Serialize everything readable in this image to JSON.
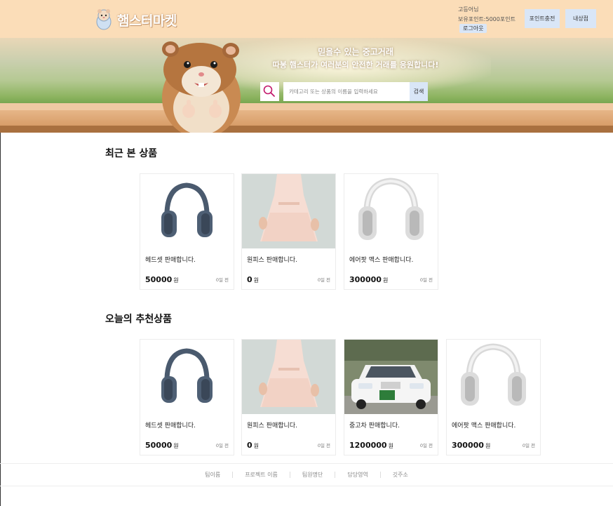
{
  "header": {
    "logo_text": "햄스터마켓",
    "user_name": "고등어님",
    "user_points": "보유포인트:5000포인트",
    "logout_label": "로그아웃",
    "charge_label": "포인트충전",
    "mystore_label": "내상점"
  },
  "banner": {
    "line1": "믿을수 있는 중고거래",
    "line2": "따봉 햄스터가 여러분의 안전한 거래를 응원합니다!",
    "search_placeholder": "카테고리 또는 상품의 이름을 입력하세요",
    "search_button": "검색"
  },
  "recent": {
    "title": "최근 본 상품",
    "items": [
      {
        "title": "헤드셋 판매합니다.",
        "price": "50000",
        "unit": "원",
        "time": "0일 전",
        "image": "headphones-blue"
      },
      {
        "title": "원피스 판매합니다.",
        "price": "0",
        "unit": "원",
        "time": "0일 전",
        "image": "dress-pink"
      },
      {
        "title": "에어팟 맥스 판매합니다.",
        "price": "300000",
        "unit": "원",
        "time": "0일 전",
        "image": "headphones-silver"
      }
    ]
  },
  "recommended": {
    "title": "오늘의 추천상품",
    "items": [
      {
        "title": "헤드셋 판매합니다.",
        "price": "50000",
        "unit": "원",
        "time": "0일 전",
        "image": "headphones-blue"
      },
      {
        "title": "원피스 판매합니다.",
        "price": "0",
        "unit": "원",
        "time": "0일 전",
        "image": "dress-pink"
      },
      {
        "title": "중고차 판매합니다.",
        "price": "1200000",
        "unit": "원",
        "time": "0일 전",
        "image": "car-white"
      },
      {
        "title": "에어팟 맥스 판매합니다.",
        "price": "300000",
        "unit": "원",
        "time": "0일 전",
        "image": "headphones-silver"
      }
    ]
  },
  "footer": {
    "items": [
      "팀이름",
      "프로젝트 이름",
      "팀원명단",
      "담당영역",
      "깃주소"
    ]
  },
  "colors": {
    "header_bg": "#fbddb8",
    "button_bg": "#d9e6f7",
    "search_icon": "#c2186b"
  }
}
